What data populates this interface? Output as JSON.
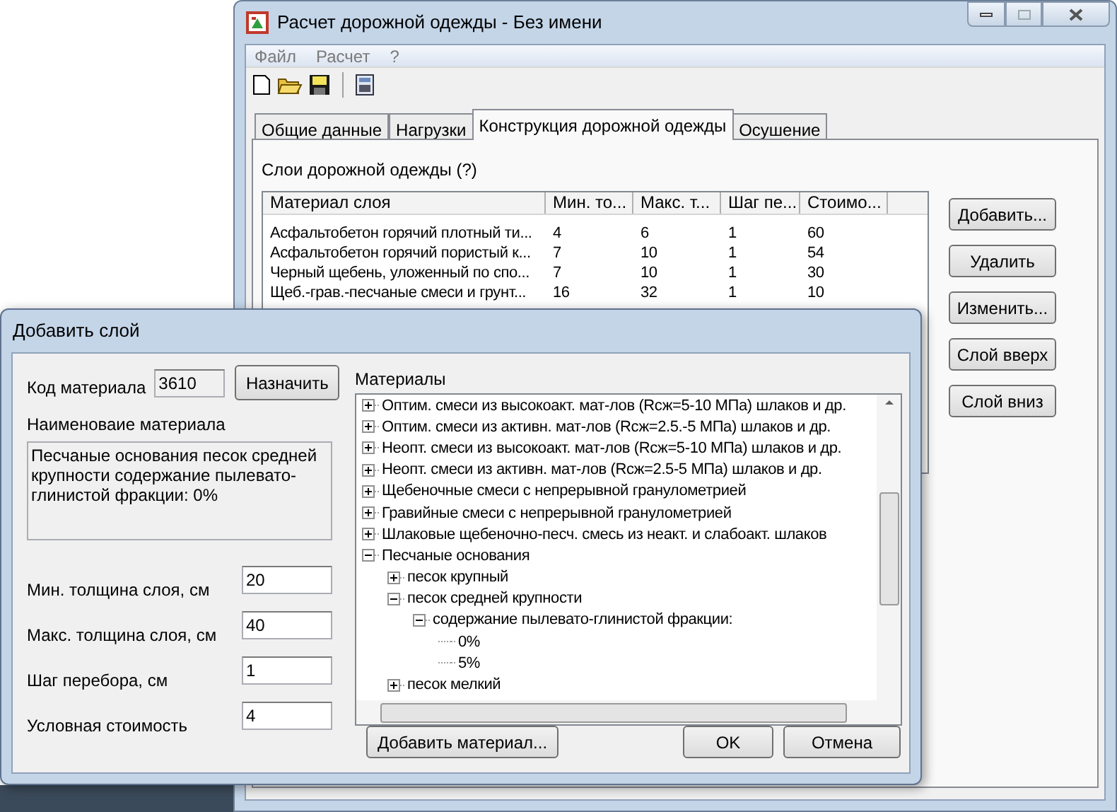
{
  "main_window": {
    "title": "Расчет дорожной одежды - Без имени",
    "menu": [
      "Файл",
      "Расчет",
      "?"
    ],
    "tabs": [
      {
        "label": "Общие данные",
        "selected": false
      },
      {
        "label": "Нагрузки",
        "selected": false
      },
      {
        "label": "Конструкция дорожной одежды",
        "selected": true
      },
      {
        "label": "Осушение",
        "selected": false
      }
    ],
    "layers_label": "Слои дорожной одежды (?)",
    "table": {
      "columns": [
        "Материал слоя",
        "Мин. то...",
        "Макс. т...",
        "Шаг пе...",
        "Стоимо..."
      ],
      "rows": [
        [
          "Асфальтобетон горячий плотный ти...",
          "4",
          "6",
          "1",
          "60"
        ],
        [
          "Асфальтобетон горячий пористый к...",
          "7",
          "10",
          "1",
          "54"
        ],
        [
          "Черный щебень, уложенный по спо...",
          "7",
          "10",
          "1",
          "30"
        ],
        [
          "Щеб.-грав.-песчаные смеси и грунт...",
          "16",
          "32",
          "1",
          "10"
        ]
      ]
    },
    "buttons": [
      "Добавить...",
      "Удалить",
      "Изменить...",
      "Слой вверх",
      "Слой вниз"
    ]
  },
  "dialog": {
    "title": "Добавить слой",
    "code_label": "Код материала",
    "code_value": "3610",
    "assign_button": "Назначить",
    "name_label": "Наименоваие материала",
    "name_value": "Песчаные основания песок средней крупности содержание пылевато-глинистой фракции: 0%",
    "fields": [
      {
        "label": "Мин. толщина слоя, см",
        "value": "20"
      },
      {
        "label": "Макс. толщина слоя, см",
        "value": "40"
      },
      {
        "label": "Шаг перебора, см",
        "value": "1"
      },
      {
        "label": "Условная стоимость",
        "value": "4"
      }
    ],
    "materials_label": "Материалы",
    "tree": [
      {
        "label": "Оптим. смеси из высокоакт. мат-лов (Rсж=5-10 МПа) шлаков и др.",
        "kind": "group",
        "expanded": false
      },
      {
        "label": "Оптим. смеси из активн. мат-лов (Rсж=2.5.-5 МПа) шлаков и др.",
        "kind": "group",
        "expanded": false
      },
      {
        "label": "Неопт. смеси из высокоакт. мат-лов (Rсж=5-10 МПа) шлаков и др.",
        "kind": "group",
        "expanded": false
      },
      {
        "label": "Неопт. смеси из активн. мат-лов (Rсж=2.5-5 МПа) шлаков и др.",
        "kind": "group",
        "expanded": false
      },
      {
        "label": "Щебеночные смеси с непрерывной гранулометрией",
        "kind": "group",
        "expanded": false
      },
      {
        "label": "Гравийные смеси с непрерывной гранулометрией",
        "kind": "group",
        "expanded": false
      },
      {
        "label": "Шлаковые щебеночно-песч. смесь из неакт. и слабоакт. шлаков",
        "kind": "group",
        "expanded": false
      },
      {
        "label": "Песчаные основания",
        "kind": "group",
        "expanded": true,
        "children": [
          {
            "label": "песок крупный",
            "kind": "group",
            "expanded": false
          },
          {
            "label": "песок средней крупности",
            "kind": "group",
            "expanded": true,
            "children": [
              {
                "label": "содержание пылевато-глинистой фракции:",
                "kind": "group",
                "expanded": true,
                "children": [
                  {
                    "label": "0%",
                    "kind": "leaf"
                  },
                  {
                    "label": "5%",
                    "kind": "leaf"
                  }
                ]
              }
            ]
          },
          {
            "label": "песок мелкий",
            "kind": "group",
            "expanded": false
          }
        ]
      }
    ],
    "buttons": [
      "Добавить материал...",
      "OK",
      "Отмена"
    ]
  }
}
